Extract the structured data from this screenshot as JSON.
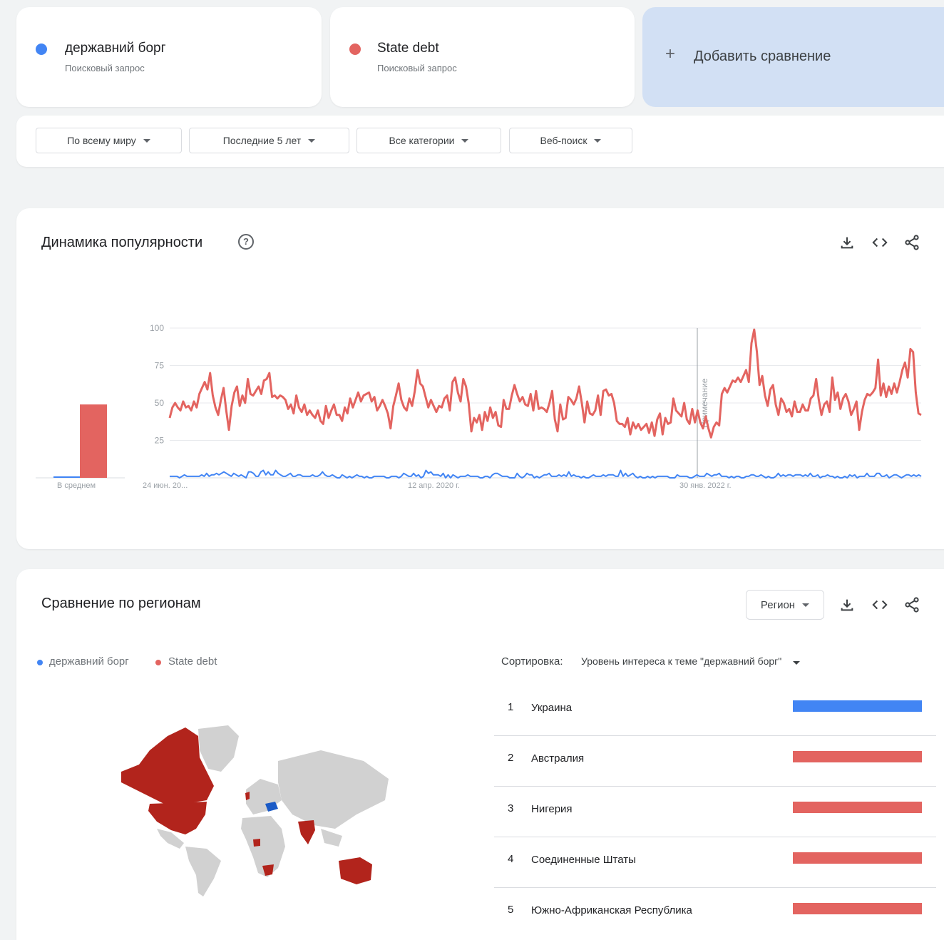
{
  "colors": {
    "blue": "#4285f4",
    "red": "#e36460",
    "map_red": "#b2241c",
    "map_blue": "#1a5ac6",
    "map_grey": "#d1d1d1"
  },
  "terms": [
    {
      "name": "державний борг",
      "sub": "Поисковый запрос",
      "color": "#4285f4"
    },
    {
      "name": "State debt",
      "sub": "Поисковый запрос",
      "color": "#e36460"
    }
  ],
  "add_compare": {
    "icon": "plus-icon",
    "label": "Добавить сравнение"
  },
  "filters": [
    {
      "label": "По всему миру"
    },
    {
      "label": "Последние 5 лет"
    },
    {
      "label": "Все категории"
    },
    {
      "label": "Веб-поиск"
    }
  ],
  "trend": {
    "title": "Динамика популярности",
    "help_icon": "help-circle-icon",
    "actions": [
      "download-icon",
      "embed-icon",
      "share-icon"
    ],
    "average_label": "В среднем",
    "annotation": "Примечание"
  },
  "chart_data": {
    "type": "line",
    "x_tick_labels": [
      "24 июн. 20...",
      "12 апр. 2020 г.",
      "30 янв. 2022 г."
    ],
    "ylim": [
      0,
      100
    ],
    "y_ticks": [
      25,
      50,
      75,
      100
    ],
    "grid": true,
    "averages": [
      {
        "name": "державний борг",
        "value": 1
      },
      {
        "name": "State debt",
        "value": 49
      }
    ],
    "series": [
      {
        "name": "State debt",
        "color": "#e36460",
        "values": [
          40,
          47,
          50,
          47,
          45,
          51,
          47,
          48,
          45,
          51,
          47,
          56,
          60,
          64,
          59,
          70,
          55,
          47,
          42,
          52,
          60,
          45,
          32,
          48,
          57,
          61,
          48,
          55,
          50,
          66,
          56,
          55,
          58,
          61,
          56,
          65,
          66,
          70,
          54,
          55,
          53,
          55,
          54,
          52,
          46,
          49,
          43,
          55,
          47,
          44,
          49,
          42,
          45,
          42,
          40,
          45,
          38,
          36,
          48,
          40,
          45,
          49,
          42,
          42,
          38,
          47,
          43,
          53,
          47,
          52,
          57,
          51,
          55,
          56,
          57,
          51,
          54,
          45,
          48,
          52,
          48,
          43,
          33,
          48,
          55,
          63,
          52,
          47,
          45,
          53,
          48,
          58,
          72,
          63,
          61,
          54,
          47,
          52,
          48,
          44,
          48,
          47,
          53,
          55,
          45,
          64,
          67,
          57,
          51,
          66,
          61,
          50,
          31,
          40,
          37,
          42,
          32,
          44,
          38,
          47,
          40,
          44,
          35,
          34,
          52,
          46,
          46,
          55,
          62,
          56,
          51,
          54,
          49,
          48,
          56,
          45,
          58,
          46,
          47,
          46,
          44,
          50,
          58,
          39,
          31,
          49,
          39,
          40,
          54,
          52,
          49,
          53,
          61,
          50,
          37,
          51,
          43,
          42,
          45,
          55,
          42,
          58,
          59,
          55,
          56,
          50,
          38,
          36,
          36,
          34,
          40,
          29,
          37,
          33,
          36,
          32,
          34,
          36,
          30,
          37,
          28,
          39,
          43,
          29,
          40,
          36,
          37,
          53,
          45,
          43,
          41,
          50,
          39,
          36,
          46,
          37,
          45,
          37,
          33,
          41,
          33,
          27,
          34,
          37,
          35,
          56,
          60,
          57,
          61,
          65,
          64,
          67,
          64,
          68,
          72,
          64,
          90,
          99,
          84,
          62,
          68,
          55,
          48,
          59,
          62,
          49,
          42,
          53,
          50,
          44,
          46,
          41,
          51,
          44,
          44,
          49,
          45,
          45,
          53,
          55,
          66,
          52,
          42,
          49,
          51,
          44,
          67,
          52,
          57,
          46,
          53,
          56,
          51,
          42,
          46,
          51,
          32,
          44,
          52,
          56,
          55,
          57,
          60,
          79,
          55,
          63,
          54,
          61,
          56,
          63,
          57,
          64,
          72,
          77,
          67,
          86,
          84,
          57,
          43,
          42
        ]
      },
      {
        "name": "державний борг",
        "color": "#4285f4",
        "values": [
          1,
          1,
          1,
          1,
          0,
          1,
          2,
          1,
          1,
          1,
          1,
          1,
          1,
          2,
          1,
          3,
          1,
          2,
          2,
          3,
          2,
          3,
          4,
          3,
          2,
          1,
          3,
          2,
          1,
          2,
          1,
          0,
          4,
          4,
          3,
          1,
          1,
          4,
          5,
          2,
          4,
          2,
          2,
          5,
          3,
          2,
          1,
          1,
          2,
          3,
          1,
          1,
          2,
          2,
          1,
          1,
          1,
          1,
          2,
          1,
          1,
          2,
          4,
          2,
          1,
          1,
          2,
          1,
          0,
          0,
          2,
          1,
          0,
          1,
          0,
          1,
          2,
          1,
          1,
          0,
          1,
          0,
          0,
          1,
          1,
          1,
          1,
          1,
          0,
          0,
          1,
          1,
          1,
          0,
          1,
          3,
          2,
          1,
          1,
          3,
          1,
          2,
          0,
          1,
          5,
          3,
          4,
          2,
          2,
          2,
          1,
          3,
          0,
          2,
          0,
          2,
          1,
          0,
          1,
          1,
          1,
          2,
          1,
          1,
          1,
          1,
          0,
          0,
          1,
          1,
          0,
          2,
          3,
          3,
          2,
          1,
          1,
          1,
          0,
          0,
          0,
          3,
          1,
          0,
          1,
          3,
          2,
          2,
          0,
          1,
          0,
          1,
          2,
          2,
          3,
          1,
          1,
          1,
          2,
          1,
          2,
          1,
          4,
          1,
          2,
          1,
          1,
          0,
          1,
          0,
          0,
          1,
          2,
          1,
          1,
          1,
          2,
          1,
          2,
          2,
          2,
          1,
          1,
          5,
          1,
          3,
          1,
          2,
          3,
          1,
          0,
          1,
          0,
          0,
          1,
          0,
          1,
          0,
          1,
          1,
          1,
          1,
          1,
          0,
          0,
          0,
          2,
          1,
          1,
          1,
          1,
          0,
          0,
          1,
          2,
          1,
          1,
          1,
          3,
          2,
          1,
          2,
          2,
          3,
          1,
          1,
          1,
          0,
          1,
          0,
          1,
          1,
          0,
          0,
          1,
          1,
          2,
          2,
          1,
          1,
          2,
          1,
          0,
          1,
          0,
          0,
          1,
          3,
          1,
          2,
          1,
          2,
          2,
          1,
          2,
          2,
          2,
          1,
          2,
          1,
          3,
          1,
          1,
          2,
          0,
          1,
          1,
          2,
          1,
          1,
          0,
          1,
          0,
          0,
          1,
          0,
          2,
          1,
          2,
          0,
          1,
          1,
          1,
          3,
          1,
          1,
          1,
          3,
          3,
          1,
          1,
          2,
          0,
          1,
          2,
          2,
          1,
          0,
          1,
          2,
          2,
          1,
          2,
          1,
          2,
          1
        ]
      }
    ]
  },
  "regions": {
    "title": "Сравнение по регионам",
    "dropdown": "Регион",
    "actions": [
      "download-icon",
      "embed-icon",
      "share-icon"
    ],
    "legend": [
      {
        "name": "державний борг",
        "color": "#4285f4"
      },
      {
        "name": "State debt",
        "color": "#e36460"
      }
    ],
    "sort_label": "Сортировка:",
    "sort_value": "Уровень интереса к теме \"державний борг\"",
    "list": [
      {
        "rank": "1",
        "name": "Украина",
        "color": "#4285f4"
      },
      {
        "rank": "2",
        "name": "Австралия",
        "color": "#e36460"
      },
      {
        "rank": "3",
        "name": "Нигерия",
        "color": "#e36460"
      },
      {
        "rank": "4",
        "name": "Соединенные Штаты",
        "color": "#e36460"
      },
      {
        "rank": "5",
        "name": "Южно-Африканская Республика",
        "color": "#e36460"
      }
    ]
  }
}
